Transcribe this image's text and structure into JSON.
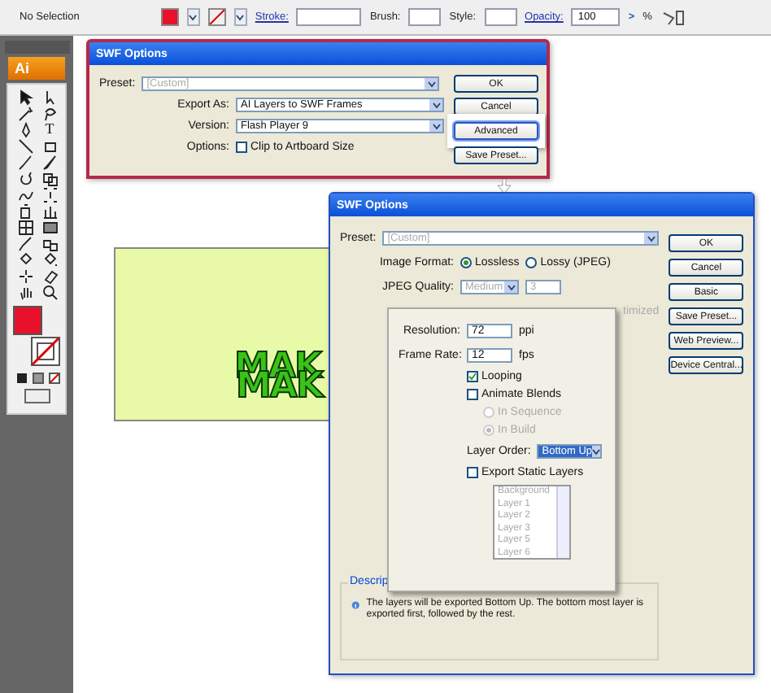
{
  "toolbar": {
    "selection_label": "No Selection",
    "stroke_label": "Stroke:",
    "brush_label": "Brush:",
    "style_label": "Style:",
    "opacity_label": "Opacity:",
    "opacity_value": "100",
    "opacity_stepper": ">",
    "percent": "%"
  },
  "tools_panel": {
    "logo": "Ai",
    "tools": [
      {
        "kind": "arrow"
      },
      {
        "kind": "hollow-arrow"
      },
      {
        "kind": "wand"
      },
      {
        "kind": "lasso"
      },
      {
        "kind": "pen"
      },
      {
        "kind": "type",
        "label": "T"
      },
      {
        "kind": "line"
      },
      {
        "kind": "rect"
      },
      {
        "kind": "brush"
      },
      {
        "kind": "pencil"
      },
      {
        "kind": "rotate"
      },
      {
        "kind": "scale"
      },
      {
        "kind": "warp"
      },
      {
        "kind": "transform"
      },
      {
        "kind": "symbol"
      },
      {
        "kind": "graph"
      },
      {
        "kind": "mesh"
      },
      {
        "kind": "gradient"
      },
      {
        "kind": "eyedropper"
      },
      {
        "kind": "blend"
      },
      {
        "kind": "paint-bucket"
      },
      {
        "kind": "paint-select"
      },
      {
        "kind": "slice"
      },
      {
        "kind": "eraser"
      },
      {
        "kind": "hand"
      },
      {
        "kind": "zoom"
      }
    ]
  },
  "artwork": {
    "lines": [
      "MAK",
      "MAK"
    ]
  },
  "basic_dialog": {
    "title": "SWF Options",
    "preset_label": "Preset:",
    "preset_value": "[Custom]",
    "preset_disabled": true,
    "export_label": "Export As:",
    "export_value": "AI Layers to SWF Frames",
    "version_label": "Version:",
    "version_value": "Flash Player 9",
    "options_label": "Options:",
    "clip": {
      "label": "Clip to Artboard Size",
      "checked": false
    },
    "buttons": [
      {
        "label": "OK",
        "highlighted": false
      },
      {
        "label": "Cancel",
        "highlighted": false
      },
      {
        "label": "Advanced",
        "highlighted": true
      },
      {
        "label": "Save Preset...",
        "highlighted": false
      }
    ]
  },
  "advanced_dialog": {
    "title": "SWF Options",
    "preset_label": "Preset:",
    "preset_value": "[Custom]",
    "preset_disabled": true,
    "image_format_label": "Image Format:",
    "formats": [
      {
        "label": "Lossless",
        "selected": true
      },
      {
        "label": "Lossy (JPEG)",
        "selected": false
      }
    ],
    "jpeg_quality_label": "JPEG Quality:",
    "jpeg_quality_value": "Medium",
    "jpeg_quality_number": "3",
    "jpeg_disabled": true,
    "cut_text": "timized",
    "buttons": [
      "OK",
      "Cancel",
      "Basic",
      "Save Preset...",
      "Web Preview...",
      "Device Central..."
    ],
    "description": {
      "legend": "Descrip",
      "text": "The layers will be exported Bottom Up. The bottom most layer is exported first, followed by the rest."
    }
  },
  "advanced_panel": {
    "resolution_label": "Resolution:",
    "resolution_value": "72",
    "resolution_unit": "ppi",
    "frame_rate_label": "Frame Rate:",
    "frame_rate_value": "12",
    "frame_rate_unit": "fps",
    "options": [
      {
        "label": "Looping",
        "checked": true
      },
      {
        "label": "Animate Blends",
        "checked": false
      }
    ],
    "blend_modes": [
      {
        "label": "In Sequence",
        "selected": false
      },
      {
        "label": "In Build",
        "selected": true
      }
    ],
    "blend_modes_disabled": true,
    "layer_order_label": "Layer Order:",
    "layer_order_value": "Bottom Up",
    "export_static": {
      "label": "Export Static Layers",
      "checked": false
    },
    "layers": [
      "Background",
      "Layer 1",
      "Layer 2",
      "Layer 3",
      "Layer 5",
      "Layer 6"
    ],
    "layers_disabled": true
  }
}
